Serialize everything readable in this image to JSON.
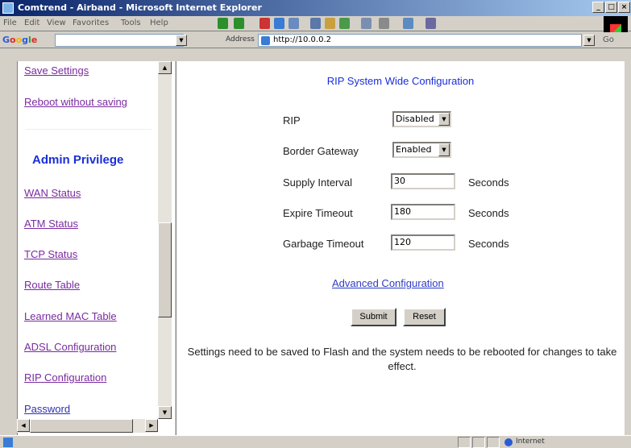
{
  "window": {
    "title": "Comtrend - Airband - Microsoft Internet Explorer"
  },
  "menu": [
    "File",
    "Edit",
    "View",
    "Favorites",
    "Tools",
    "Help"
  ],
  "toolbar": {
    "google": "Google",
    "address_label": "Address",
    "address": "http://10.0.0.2",
    "go": "Go"
  },
  "sidebar": {
    "items_top": [
      "Save Settings",
      "Reboot without saving"
    ],
    "heading": "Admin Privilege",
    "items": [
      "WAN Status",
      "ATM Status",
      "TCP Status",
      "Route Table",
      "Learned MAC Table",
      "ADSL Configuration",
      "RIP Configuration",
      "Password"
    ]
  },
  "main": {
    "title": "RIP System Wide Configuration",
    "fields": {
      "rip": {
        "label": "RIP",
        "value": "Disabled"
      },
      "border_gateway": {
        "label": "Border Gateway",
        "value": "Enabled"
      },
      "supply_interval": {
        "label": "Supply Interval",
        "value": "30",
        "unit": "Seconds"
      },
      "expire_timeout": {
        "label": "Expire Timeout",
        "value": "180",
        "unit": "Seconds"
      },
      "garbage_timeout": {
        "label": "Garbage Timeout",
        "value": "120",
        "unit": "Seconds"
      }
    },
    "advanced_link": "Advanced Configuration",
    "submit_label": "Submit",
    "reset_label": "Reset",
    "note": "Settings need to be saved to Flash and the system needs to be rebooted for changes to take effect."
  },
  "status": {
    "zone": "Internet"
  }
}
